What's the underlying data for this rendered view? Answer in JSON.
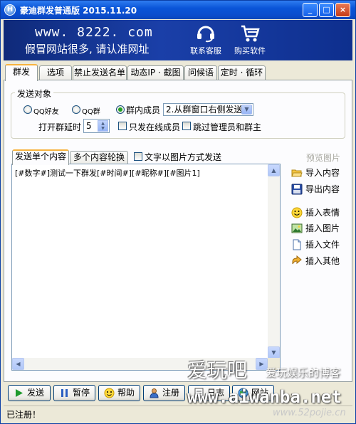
{
  "window": {
    "title": "豪迪群发普通版 2015.11.20",
    "controls": {
      "minimize": "_",
      "maximize": "□",
      "close": "×"
    },
    "colors": {
      "titlebar": "#0a55d8",
      "banner": "#1a3fa8",
      "accent_tab": "#f7b33e"
    }
  },
  "banner": {
    "url": "www. 8222. com",
    "slogan": "假冒网站很多, 请认准网址",
    "support_label": "联系客服",
    "support_icon": "headset-icon",
    "buy_label": "购买软件",
    "buy_icon": "cart-icon"
  },
  "tabs": [
    "群发",
    "选项",
    "禁止发送名单",
    "动态IP · 截图",
    "问候语",
    "定时 · 循环"
  ],
  "active_tab": "群发",
  "send_target": {
    "legend": "发送对象",
    "options": [
      {
        "label": "QQ好友",
        "checked": false
      },
      {
        "label": "QQ群",
        "checked": false
      },
      {
        "label": "群内成员",
        "checked": true
      }
    ],
    "mode_select": {
      "value": "2.从群窗口右侧发送"
    },
    "delay_label": "打开群延时",
    "delay_value": "5",
    "only_online_label": "只发在线成员",
    "skip_admin_label": "跳过管理员和群主"
  },
  "content_tabs": [
    "发送单个内容",
    "多个内容轮换"
  ],
  "active_content_tab": "发送单个内容",
  "image_mode_label": "文字以图片方式发送",
  "editor_text": "[#数字#]测试一下群发[#时间#][#昵称#][#图片1]",
  "side_actions": {
    "preview": "预览图片",
    "items": [
      {
        "label": "导入内容",
        "icon": "folder-open-icon"
      },
      {
        "label": "导出内容",
        "icon": "save-disk-icon"
      },
      {
        "label": "插入表情",
        "icon": "smiley-icon"
      },
      {
        "label": "插入图片",
        "icon": "picture-icon"
      },
      {
        "label": "插入文件",
        "icon": "file-icon"
      },
      {
        "label": "插入其他",
        "icon": "insert-arrow-icon"
      }
    ]
  },
  "bottom_buttons": [
    {
      "label": "发送",
      "icon": "play-icon"
    },
    {
      "label": "暂停",
      "icon": "pause-icon"
    },
    {
      "label": "帮助",
      "icon": "help-face-icon"
    },
    {
      "label": "注册",
      "icon": "user-icon"
    },
    {
      "label": "日志",
      "icon": "log-icon"
    },
    {
      "label": "网站",
      "icon": "globe-icon"
    }
  ],
  "status": "已注册！",
  "watermark": {
    "brand": "爱玩吧",
    "tagline": "爱玩娱乐的博客",
    "url": "www.aiwanba.net",
    "source": "www.52pojie.cn"
  }
}
